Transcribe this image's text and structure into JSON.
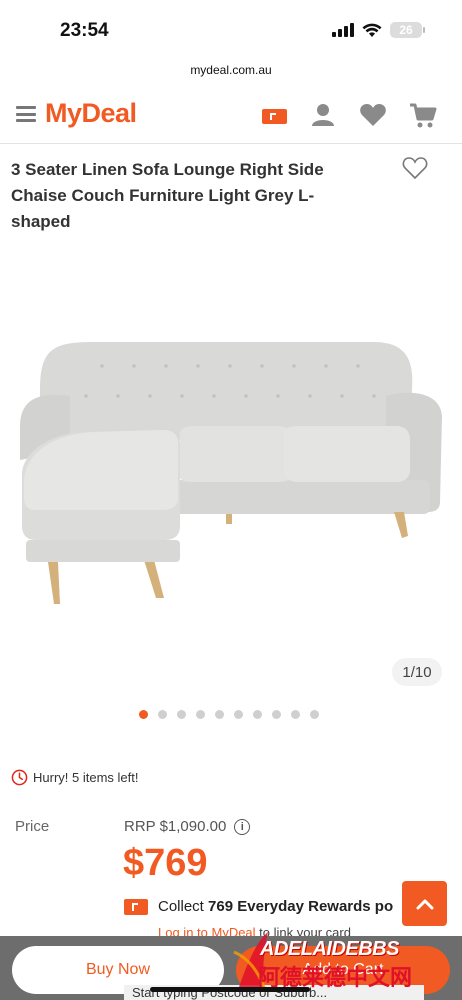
{
  "status_bar": {
    "time": "23:54",
    "battery": "26"
  },
  "browser": {
    "url": "mydeal.com.au"
  },
  "header": {
    "logo": "MyDeal"
  },
  "product": {
    "title": "3 Seater Linen Sofa Lounge Right Side Chaise Couch Furniture Light Grey L-shaped",
    "image_counter": "1/10",
    "image_count": 10,
    "active_image": 1,
    "stock_text": "Hurry! 5 items left!"
  },
  "pricing": {
    "label": "Price",
    "rrp": "RRP $1,090.00",
    "price": "$769",
    "collect_prefix": "Collect ",
    "collect_bold": "769 Everyday Rewards po",
    "login_link": "Log in to MyDeal",
    "login_suffix": " to link your card"
  },
  "actions": {
    "buy_now": "Buy Now",
    "add_to_cart": "Add to Cart",
    "hint": "Start typing Postcode or Suburb..."
  },
  "watermark": {
    "en": "ADELAIDEBBS",
    "cn": "阿德莱德中文网"
  },
  "colors": {
    "accent": "#f15a22",
    "bottom_bar": "#6d6d6d"
  }
}
